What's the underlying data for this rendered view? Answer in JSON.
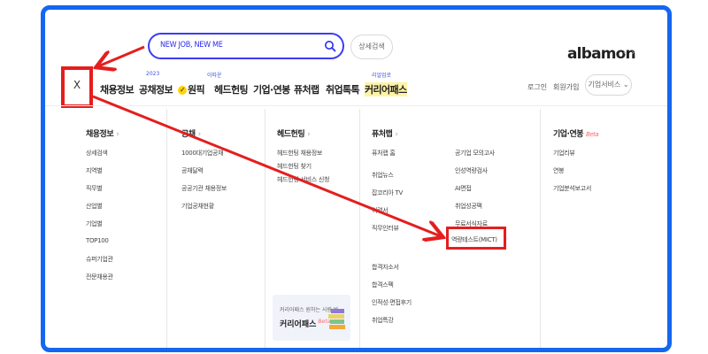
{
  "search": {
    "query": "NEW JOB, NEW ME",
    "icon": "search-icon"
  },
  "header": {
    "detail_search_label": "상세검색",
    "logo_text": "albamon",
    "logo_prev": "‹",
    "logo_next": "›"
  },
  "nav": {
    "close_label": "X",
    "items": [
      {
        "label": "채용정보",
        "badge": ""
      },
      {
        "label": "공채정보",
        "badge": "2023"
      },
      {
        "label": "원픽",
        "badge": "이따운"
      },
      {
        "label": "헤드헌팅",
        "badge": ""
      },
      {
        "label": "기업·연봉",
        "badge": ""
      },
      {
        "label": "퓨처랩",
        "badge": ""
      },
      {
        "label": "취업톡톡",
        "badge": ""
      },
      {
        "label": "커리어패스",
        "badge": "리얼업로"
      }
    ],
    "login_label": "로그인",
    "signup_label": "회원가입",
    "business_label": "기업서비스",
    "business_chevron": "⌄"
  },
  "menu": {
    "col1": {
      "title": "채용정보",
      "chev": "›",
      "items": [
        "상세검색",
        "지역별",
        "직무별",
        "산업별",
        "기업별",
        "TOP100",
        "슈퍼기업관",
        "전문채용관"
      ]
    },
    "col2": {
      "title": "공채",
      "chev": "›",
      "items": [
        "1000대기업공채",
        "공채달력",
        "공공기관 채용정보",
        "기업공채현황"
      ]
    },
    "col3": {
      "title": "헤드헌팅",
      "chev": "›",
      "items": [
        "헤드헌팅 채용정보",
        "헤드헌팅 찾기",
        "헤드헌팅 서비스 신청"
      ]
    },
    "col4": {
      "title": "퓨처랩",
      "chev": "›",
      "left_items": [
        "퓨처랩 홈",
        "취업뉴스",
        "잡코리아 TV",
        "이력서",
        "직무인터뷰"
      ],
      "right_items": [
        "공기업 모의고사",
        "인성역량검사",
        "AI면접",
        "취업성공팩",
        "무료서식자료",
        "역량테스트(MICT)"
      ],
      "bottom_items": [
        "합격자소서",
        "합격스펙",
        "인적성·면접후기",
        "취업특강"
      ]
    },
    "col5": {
      "title": "기업·연봉",
      "beta": "Beta",
      "items": [
        "기업리뷰",
        "연봉",
        "기업분석보고서"
      ]
    }
  },
  "banner": {
    "subtitle": "커리어패스 원하는 사람 봐,",
    "title": "커리어패스",
    "beta": "Beta"
  }
}
